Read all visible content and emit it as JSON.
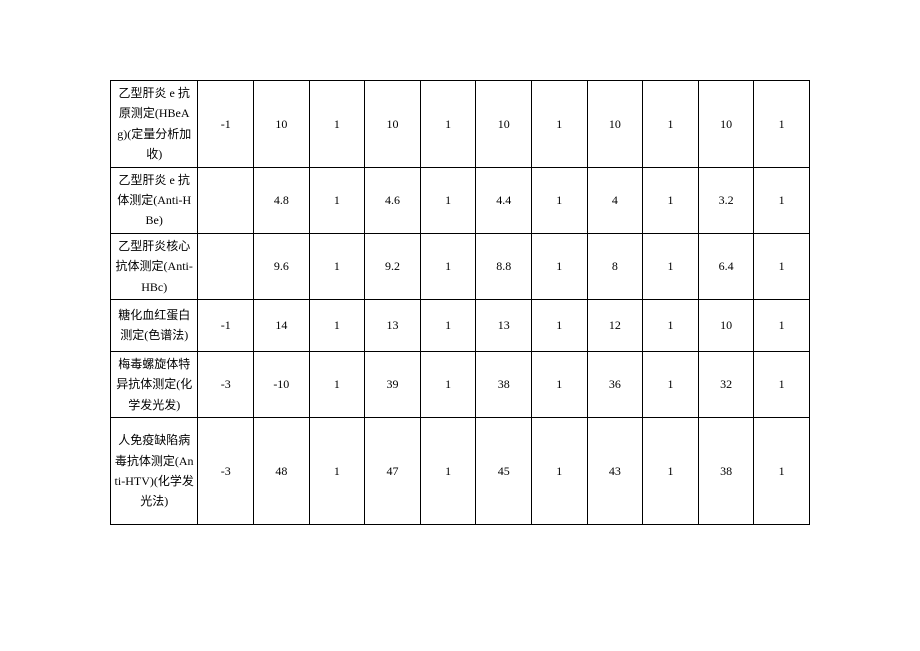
{
  "rows": [
    {
      "name": "乙型肝炎 e 抗原测定(HBeAg)(定量分析加收)",
      "c1": "-1",
      "c2": "10",
      "c3": "1",
      "c4": "10",
      "c5": "1",
      "c6": "10",
      "c7": "1",
      "c8": "10",
      "c9": "1",
      "c10": "10",
      "c11": "1"
    },
    {
      "name": "乙型肝炎 e 抗体测定(Anti-HBe)",
      "c1": "",
      "c2": "4.8",
      "c3": "1",
      "c4": "4.6",
      "c5": "1",
      "c6": "4.4",
      "c7": "1",
      "c8": "4",
      "c9": "1",
      "c10": "3.2",
      "c11": "1"
    },
    {
      "name": "乙型肝炎核心抗体测定(Anti-HBc)",
      "c1": "",
      "c2": "9.6",
      "c3": "1",
      "c4": "9.2",
      "c5": "1",
      "c6": "8.8",
      "c7": "1",
      "c8": "8",
      "c9": "1",
      "c10": "6.4",
      "c11": "1"
    },
    {
      "name": "糖化血红蛋白测定(色谱法)",
      "c1": "-1",
      "c2": "14",
      "c3": "1",
      "c4": "13",
      "c5": "1",
      "c6": "13",
      "c7": "1",
      "c8": "12",
      "c9": "1",
      "c10": "10",
      "c11": "1"
    },
    {
      "name": "梅毒螺旋体特异抗体测定(化学发光发)",
      "c1": "-3",
      "c2": "-10",
      "c3": "1",
      "c4": "39",
      "c5": "1",
      "c6": "38",
      "c7": "1",
      "c8": "36",
      "c9": "1",
      "c10": "32",
      "c11": "1"
    },
    {
      "name": "人免疫缺陷病毒抗体测定(Anti-HTV)(化学发光法)",
      "c1": "-3",
      "c2": "48",
      "c3": "1",
      "c4": "47",
      "c5": "1",
      "c6": "45",
      "c7": "1",
      "c8": "43",
      "c9": "1",
      "c10": "38",
      "c11": "1"
    }
  ]
}
